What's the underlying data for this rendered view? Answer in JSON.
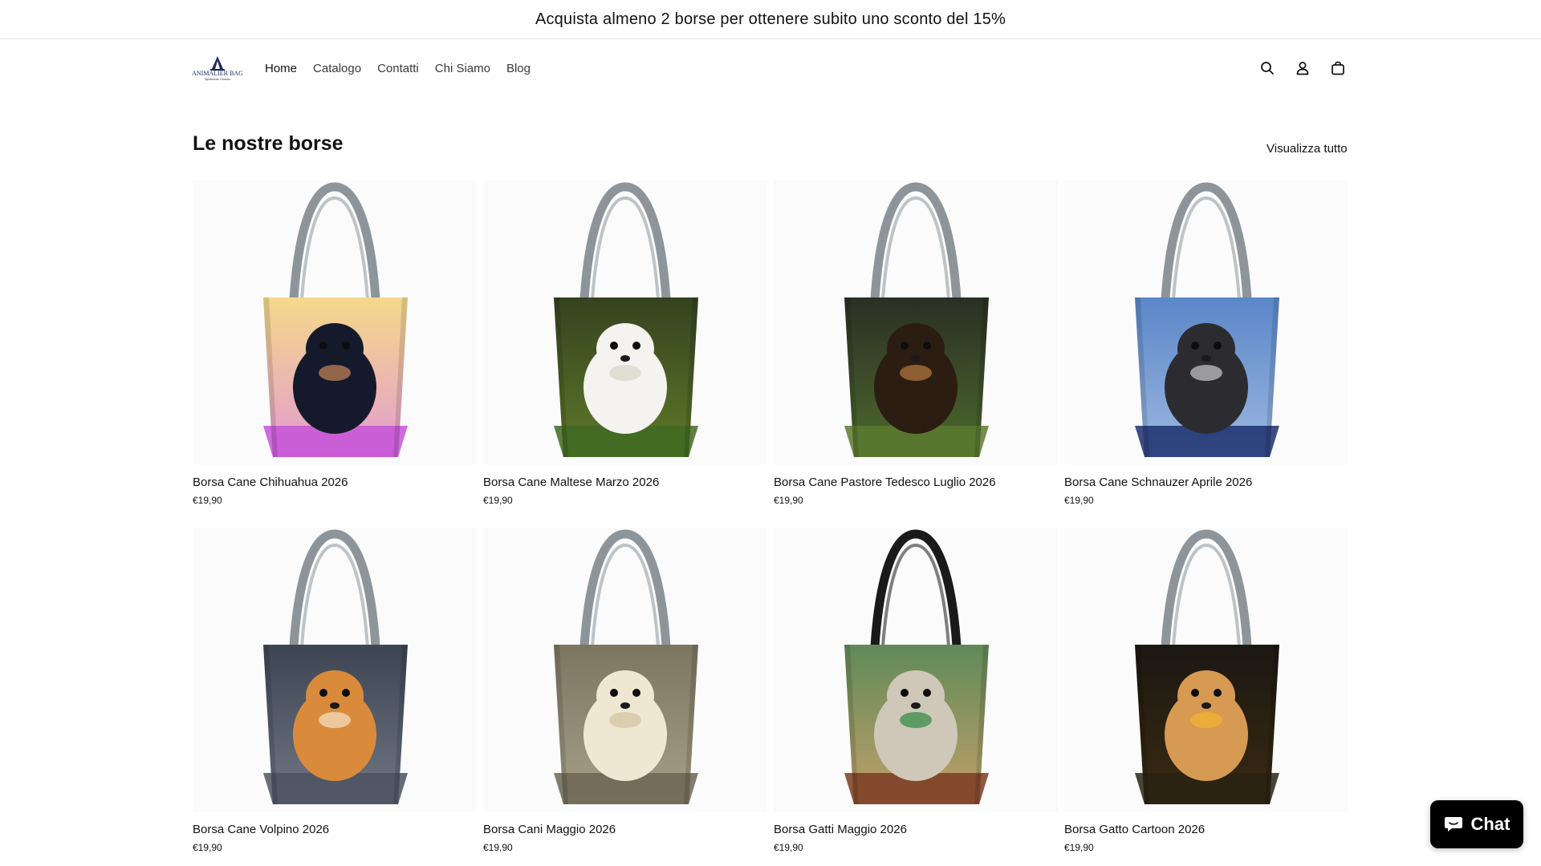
{
  "announcement": {
    "text": "Acquista almeno 2 borse per ottenere subito uno sconto del 15%"
  },
  "header": {
    "logo_text": "ANIMALIER BAG",
    "logo_sub": "Spedizione Gratuita",
    "nav": [
      {
        "label": "Home",
        "active": true
      },
      {
        "label": "Catalogo"
      },
      {
        "label": "Contatti"
      },
      {
        "label": "Chi Siamo"
      },
      {
        "label": "Blog"
      }
    ],
    "icons": [
      "search-icon",
      "account-icon",
      "cart-icon"
    ]
  },
  "section": {
    "title": "Le nostre borse",
    "view_all": "Visualizza tutto"
  },
  "products": [
    {
      "title": "Borsa Cane Chihuahua 2026",
      "price": "€19,90",
      "image": "chihuahua",
      "handle_color": "#8d959b"
    },
    {
      "title": "Borsa Cane Maltese Marzo 2026",
      "price": "€19,90",
      "image": "maltese",
      "handle_color": "#8d959b"
    },
    {
      "title": "Borsa Cane Pastore Tedesco Luglio 2026",
      "price": "€19,90",
      "image": "german-shepherd",
      "handle_color": "#8d959b"
    },
    {
      "title": "Borsa Cane Schnauzer Aprile 2026",
      "price": "€19,90",
      "image": "schnauzer",
      "handle_color": "#8d959b"
    },
    {
      "title": "Borsa Cane Volpino 2026",
      "price": "€19,90",
      "image": "pomeranian",
      "handle_color": "#8d959b"
    },
    {
      "title": "Borsa Cani Maggio 2026",
      "price": "€19,90",
      "image": "labrador",
      "handle_color": "#8d959b"
    },
    {
      "title": "Borsa Gatti Maggio 2026",
      "price": "€19,90",
      "image": "cats-kitchen",
      "handle_color": "#1a1a1a"
    },
    {
      "title": "Borsa Gatto Cartoon 2026",
      "price": "€19,90",
      "image": "cat-cartoon",
      "handle_color": "#8d959b"
    }
  ],
  "chat": {
    "label": "Chat"
  },
  "colors": {
    "text": "#121212",
    "chat_bg": "#000000",
    "announcement_border": "#e6e6e6"
  }
}
